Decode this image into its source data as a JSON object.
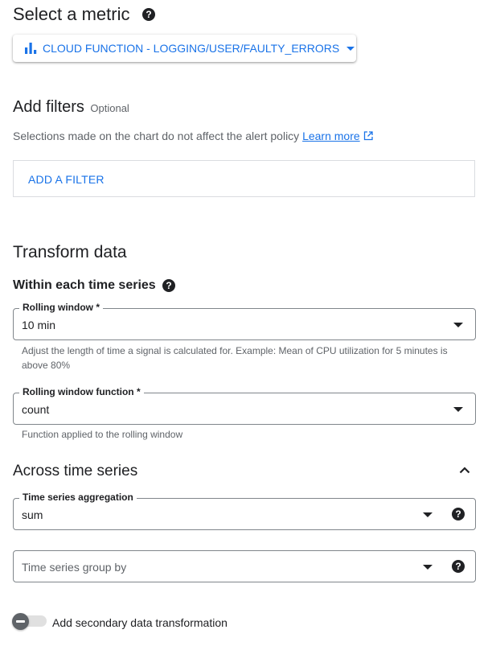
{
  "metric_section": {
    "title": "Select a metric",
    "selected_metric": "CLOUD FUNCTION - LOGGING/USER/FAULTY_ERRORS"
  },
  "filters_section": {
    "title": "Add filters",
    "optional": "Optional",
    "description": "Selections made on the chart do not affect the alert policy",
    "learn_more": "Learn more",
    "add_filter": "ADD A FILTER"
  },
  "transform_section": {
    "title": "Transform data",
    "within_title": "Within each time series",
    "rolling_window": {
      "label": "Rolling window *",
      "value": "10 min",
      "hint": "Adjust the length of time a signal is calculated for. Example: Mean of CPU utilization for 5 minutes is above 80%"
    },
    "rolling_function": {
      "label": "Rolling window function *",
      "value": "count",
      "hint": "Function applied to the rolling window"
    },
    "across_title": "Across time series",
    "aggregation": {
      "label": "Time series aggregation",
      "value": "sum"
    },
    "group_by": {
      "placeholder": "Time series group by"
    },
    "secondary_toggle_label": "Add secondary data transformation"
  },
  "colors": {
    "accent": "#1a73e8",
    "text": "#202124",
    "muted": "#5f6368",
    "border": "#80868b"
  }
}
